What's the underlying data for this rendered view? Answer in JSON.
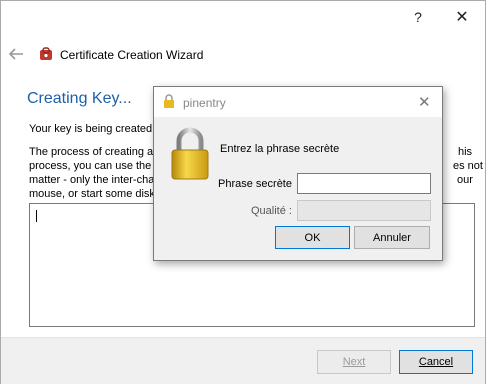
{
  "window": {
    "help_glyph": "?",
    "close_glyph": "✕"
  },
  "wizard": {
    "title": "Certificate Creation Wizard",
    "heading": "Creating Key...",
    "status": "Your key is being created.",
    "lines": [
      {
        "left": "The process of creating a k",
        "right": "his"
      },
      {
        "left": "process, you can use the c",
        "right": "es not"
      },
      {
        "left": "matter - only the inter-cha",
        "right": "our"
      },
      {
        "left": "mouse, or start some disk-",
        "right": ""
      }
    ],
    "buttons": {
      "next": "Next",
      "cancel": "Cancel"
    }
  },
  "pinentry": {
    "title": "pinentry",
    "close_glyph": "✕",
    "prompt": "Entrez la phrase secrète",
    "passphrase_label": "Phrase secrète",
    "passphrase_value": "",
    "quality_label": "Qualité :",
    "quality_level": 0,
    "buttons": {
      "ok": "OK",
      "cancel": "Annuler"
    }
  },
  "colors": {
    "heading": "#1f5fa8",
    "accent": "#0078d7",
    "lock_gold": "#e8b821"
  },
  "icons": [
    "back-arrow-icon",
    "certificate-wizard-icon",
    "lock-icon"
  ]
}
